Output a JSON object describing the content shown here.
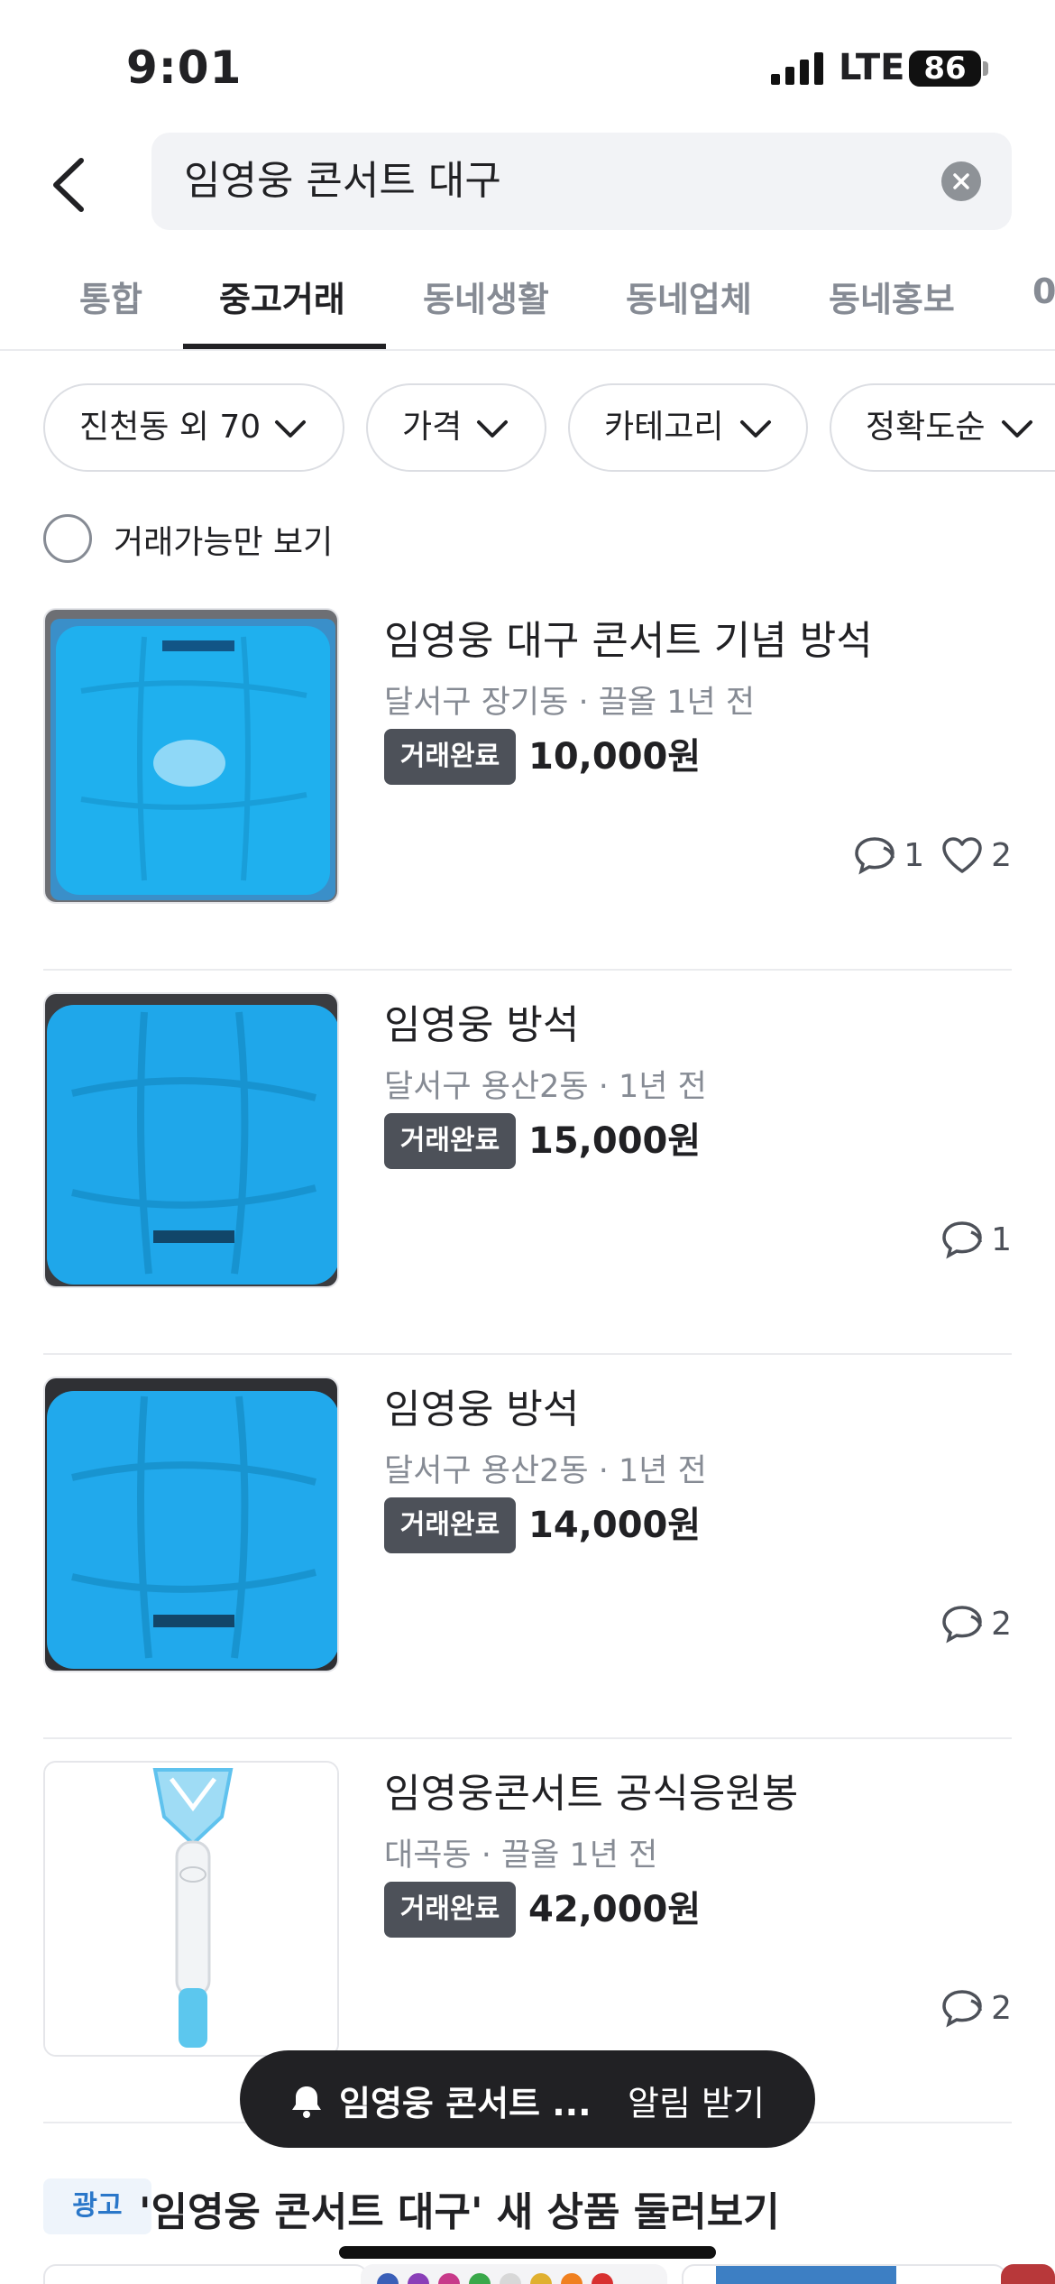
{
  "status": {
    "time": "9:01",
    "network": "LTE",
    "battery": "86"
  },
  "search": {
    "query": "임영웅 콘서트 대구"
  },
  "tabs": [
    {
      "label": "통합"
    },
    {
      "label": "중고거래"
    },
    {
      "label": "동네생활"
    },
    {
      "label": "동네업체"
    },
    {
      "label": "동네홍보"
    },
    {
      "label": "0"
    }
  ],
  "filters": [
    {
      "label": "진천동 외 70"
    },
    {
      "label": "가격"
    },
    {
      "label": "카테고리"
    },
    {
      "label": "정확도순"
    }
  ],
  "available_only": {
    "label": "거래가능만 보기",
    "checked": false
  },
  "listings": [
    {
      "title": "임영웅 대구 콘서트 기념 방석",
      "meta": "달서구 장기동 · 끌올 1년 전",
      "badge": "거래완료",
      "price": "10,000원",
      "comments": "1",
      "likes": "2",
      "thumb": "cushion-bag"
    },
    {
      "title": "임영웅 방석",
      "meta": "달서구 용산2동 · 1년 전",
      "badge": "거래완료",
      "price": "15,000원",
      "comments": "1",
      "likes": "",
      "thumb": "cushion"
    },
    {
      "title": "임영웅 방석",
      "meta": "달서구 용산2동 · 1년 전",
      "badge": "거래완료",
      "price": "14,000원",
      "comments": "2",
      "likes": "",
      "thumb": "cushion"
    },
    {
      "title": "임영웅콘서트 공식응원봉",
      "meta": "대곡동 · 끌올 1년 전",
      "badge": "거래완료",
      "price": "42,000원",
      "comments": "2",
      "likes": "",
      "thumb": "lightstick"
    }
  ],
  "alert": {
    "keyword": "임영웅 콘서트 ...",
    "action": "알림 받기"
  },
  "ad": {
    "badge": "광고",
    "title": "'임영웅 콘서트 대구' 새 상품 둘러보기"
  },
  "colors": {
    "accent_cushion": "#1fb0ee",
    "dark": "#212124",
    "muted": "#868b94"
  }
}
